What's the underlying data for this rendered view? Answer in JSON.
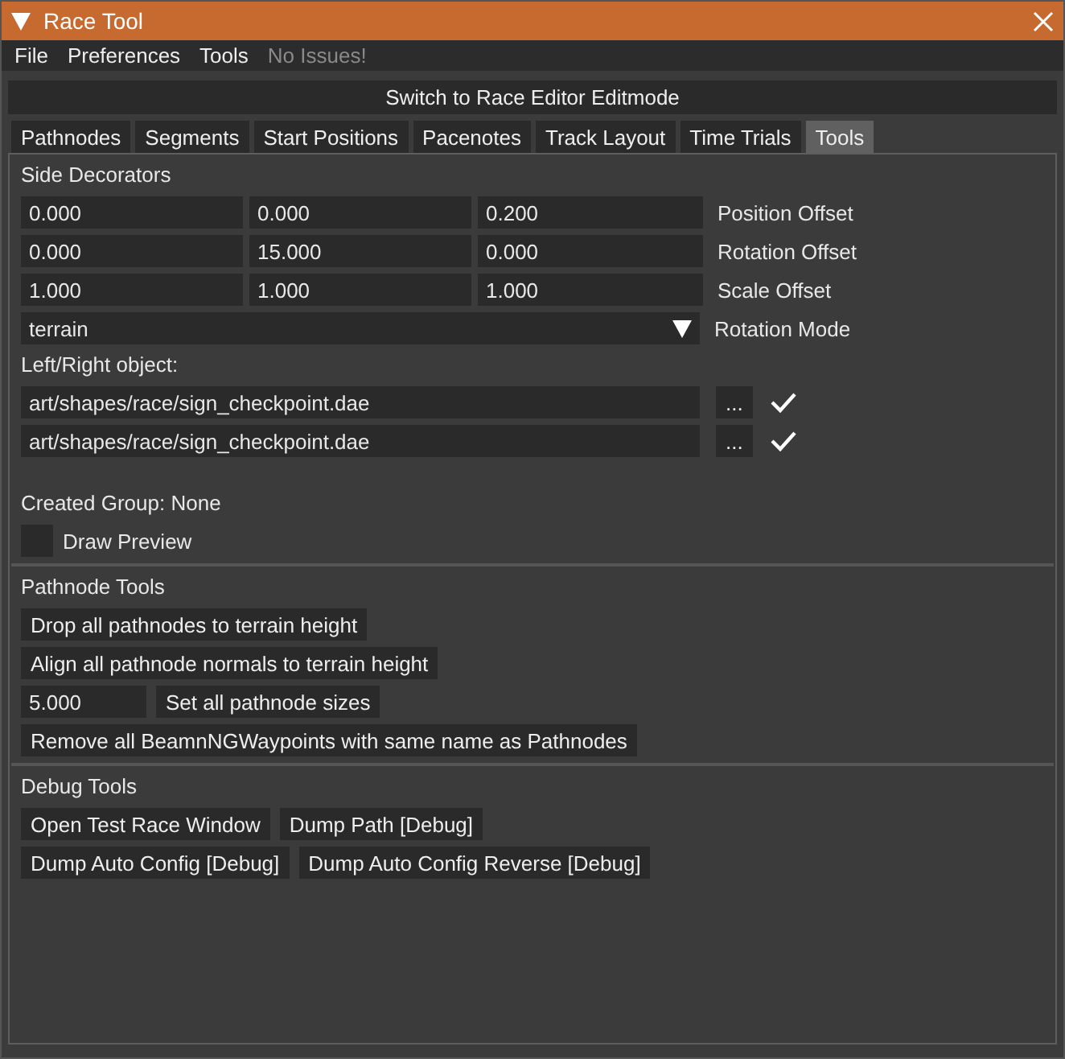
{
  "window": {
    "title": "Race Tool"
  },
  "menu": [
    {
      "label": "File",
      "disabled": false
    },
    {
      "label": "Preferences",
      "disabled": false
    },
    {
      "label": "Tools",
      "disabled": false
    },
    {
      "label": "No Issues!",
      "disabled": true
    }
  ],
  "mode_button": "Switch to Race Editor Editmode",
  "tabs": [
    {
      "label": "Pathnodes",
      "selected": false
    },
    {
      "label": "Segments",
      "selected": false
    },
    {
      "label": "Start Positions",
      "selected": false
    },
    {
      "label": "Pacenotes",
      "selected": false
    },
    {
      "label": "Track Layout",
      "selected": false
    },
    {
      "label": "Time Trials",
      "selected": false
    },
    {
      "label": "Tools",
      "selected": true
    }
  ],
  "side_decorators": {
    "title": "Side Decorators",
    "vectors": [
      {
        "values": [
          "0.000",
          "0.000",
          "0.200"
        ],
        "label": "Position Offset"
      },
      {
        "values": [
          "0.000",
          "15.000",
          "0.000"
        ],
        "label": "Rotation Offset"
      },
      {
        "values": [
          "1.000",
          "1.000",
          "1.000"
        ],
        "label": "Scale Offset"
      }
    ],
    "rotation_mode": {
      "value": "terrain",
      "label": "Rotation Mode"
    },
    "objects_label": "Left/Right object:",
    "objects": [
      {
        "path": "art/shapes/race/sign_checkpoint.dae",
        "browse": "...",
        "valid": true
      },
      {
        "path": "art/shapes/race/sign_checkpoint.dae",
        "browse": "...",
        "valid": true
      }
    ],
    "created_group": "Created Group: None",
    "draw_preview": {
      "label": "Draw Preview",
      "checked": false
    }
  },
  "pathnode_tools": {
    "title": "Pathnode Tools",
    "drop_button": "Drop all pathnodes to terrain height",
    "align_button": "Align all pathnode normals to terrain height",
    "size_value": "5.000",
    "size_button": "Set all pathnode sizes",
    "remove_button": "Remove all BeamnNGWaypoints with same name as Pathnodes"
  },
  "debug_tools": {
    "title": "Debug Tools",
    "rows": [
      [
        "Open Test Race Window",
        "Dump Path [Debug]"
      ],
      [
        "Dump Auto Config [Debug]",
        "Dump Auto Config Reverse [Debug]"
      ]
    ]
  }
}
